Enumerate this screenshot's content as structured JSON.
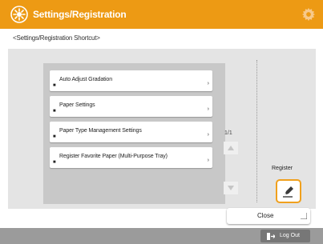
{
  "header": {
    "title": "Settings/Registration",
    "title_icon": "settings-registration-icon",
    "settings_icon": "gear-icon"
  },
  "breadcrumb": {
    "text": "<Settings/Registration Shortcut>"
  },
  "menu": {
    "items": [
      {
        "label": "Auto Adjust Gradation"
      },
      {
        "label": "Paper Settings"
      },
      {
        "label": "Paper Type Management Settings"
      },
      {
        "label": "Register Favorite Paper (Multi-Purpose Tray)"
      }
    ]
  },
  "pager": {
    "text": "1/1",
    "up_icon": "triangle-up-icon",
    "down_icon": "triangle-down-icon"
  },
  "register": {
    "label": "Register",
    "icon": "pen-icon"
  },
  "actions": {
    "close_label": "Close"
  },
  "footer": {
    "logout_label": "Log Out",
    "logout_icon": "log-out-icon"
  },
  "colors": {
    "accent": "#ed9a14",
    "panel": "#e4e4e4",
    "list_bg": "#c8c8c8",
    "footer": "#9b9b9b"
  }
}
